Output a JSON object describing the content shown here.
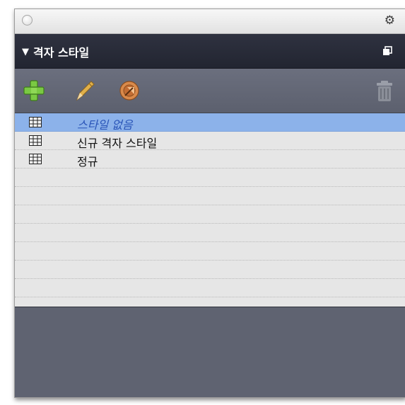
{
  "panel": {
    "title": "격자 스타일",
    "title_triangle": "▼",
    "gear_glyph": "⚙"
  },
  "toolbar": {
    "icons": [
      "add-icon",
      "pencil-icon",
      "duplicate-icon",
      "trash-icon"
    ],
    "add_color": "#7ac943",
    "pencil_color": "#d6a23a",
    "duplicate_color": "#c77a3a"
  },
  "list": {
    "items": [
      {
        "label": "스타일 없음",
        "selected": true
      },
      {
        "label": "신규 격자 스타일",
        "selected": false
      },
      {
        "label": "정규",
        "selected": false
      }
    ],
    "empty_rows": 7
  },
  "colors": {
    "selection": "#8cb2ea",
    "header_bg": "#262936",
    "panel_bg": "#5d6170"
  }
}
